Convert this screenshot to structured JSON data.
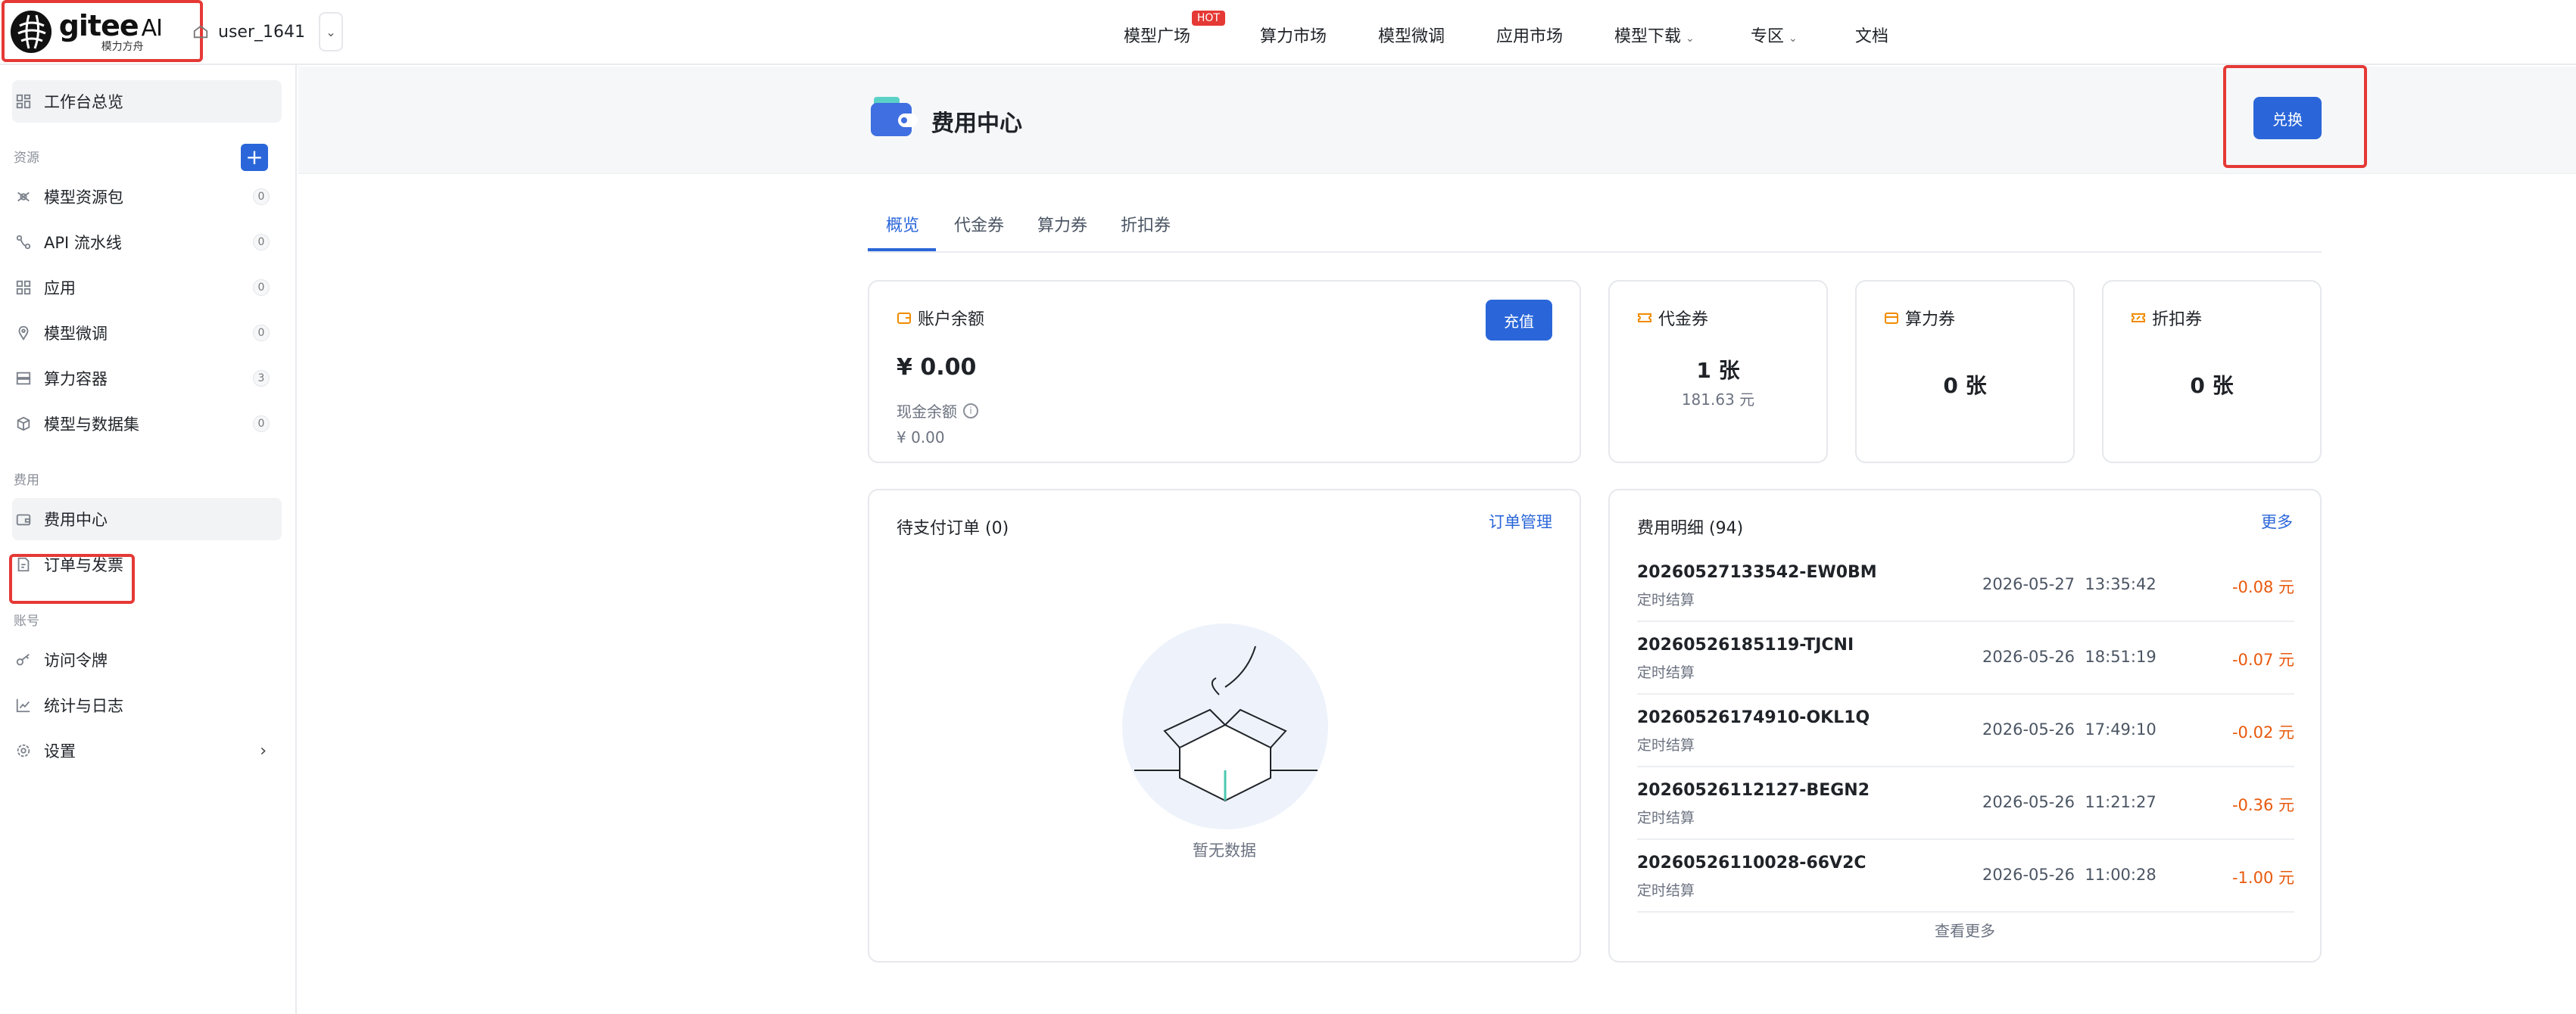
{
  "brand": {
    "name": "gitee",
    "suffix": "AI",
    "subtitle": "模力方舟"
  },
  "workspace": {
    "user": "user_1641"
  },
  "nav": {
    "items": [
      {
        "label": "模型广场",
        "badge": "HOT"
      },
      {
        "label": "算力市场"
      },
      {
        "label": "模型微调"
      },
      {
        "label": "应用市场"
      },
      {
        "label": "模型下载",
        "dropdown": true
      },
      {
        "label": "专区",
        "dropdown": true
      },
      {
        "label": "文档"
      }
    ]
  },
  "sidebar": {
    "overview": "工作台总览",
    "sections": {
      "resources": "资源",
      "billing": "费用",
      "account": "账号"
    },
    "resources": [
      {
        "label": "模型资源包",
        "count": "0",
        "icon": "package-icon"
      },
      {
        "label": "API 流水线",
        "count": "0",
        "icon": "pipeline-icon"
      },
      {
        "label": "应用",
        "count": "0",
        "icon": "apps-icon"
      },
      {
        "label": "模型微调",
        "count": "0",
        "icon": "finetune-icon"
      },
      {
        "label": "算力容器",
        "count": "3",
        "icon": "server-icon"
      },
      {
        "label": "模型与数据集",
        "count": "0",
        "icon": "cube-icon"
      }
    ],
    "billing": [
      {
        "label": "费用中心",
        "active": true,
        "icon": "wallet-icon"
      },
      {
        "label": "订单与发票",
        "icon": "invoice-icon"
      }
    ],
    "account": [
      {
        "label": "访问令牌",
        "icon": "key-icon"
      },
      {
        "label": "统计与日志",
        "icon": "chart-icon"
      },
      {
        "label": "设置",
        "icon": "gear-icon"
      }
    ]
  },
  "page": {
    "title": "费用中心",
    "exchange_label": "兑换",
    "tabs": [
      "概览",
      "代金券",
      "算力券",
      "折扣券"
    ]
  },
  "account_card": {
    "title": "账户余额",
    "balance": "¥ 0.00",
    "cash_label": "现金余额",
    "cash_value": "¥ 0.00",
    "recharge_label": "充值"
  },
  "vouchers": [
    {
      "title": "代金券",
      "count": "1 张",
      "sub": "181.63 元"
    },
    {
      "title": "算力券",
      "count": "0 张"
    },
    {
      "title": "折扣券",
      "count": "0 张"
    }
  ],
  "pending_orders": {
    "title": "待支付订单 (0)",
    "link": "订单管理",
    "empty": "暂无数据"
  },
  "fees": {
    "title": "费用明细 (94)",
    "more_link": "更多",
    "see_more": "查看更多",
    "rows": [
      {
        "id": "20260527133542-EW0BM",
        "type": "定时结算",
        "date": "2026-05-27  13:35:42",
        "amount": "-0.08 元"
      },
      {
        "id": "20260526185119-TJCNI",
        "type": "定时结算",
        "date": "2026-05-26  18:51:19",
        "amount": "-0.07 元"
      },
      {
        "id": "20260526174910-OKL1Q",
        "type": "定时结算",
        "date": "2026-05-26  17:49:10",
        "amount": "-0.02 元"
      },
      {
        "id": "20260526112127-BEGN2",
        "type": "定时结算",
        "date": "2026-05-26  11:21:27",
        "amount": "-0.36 元"
      },
      {
        "id": "20260526110028-66V2C",
        "type": "定时结算",
        "date": "2026-05-26  11:00:28",
        "amount": "-1.00 元"
      }
    ]
  },
  "colors": {
    "primary": "#2a66d9",
    "negative": "#e8590c",
    "annotation": "#e53935",
    "hot": "#e53935"
  }
}
